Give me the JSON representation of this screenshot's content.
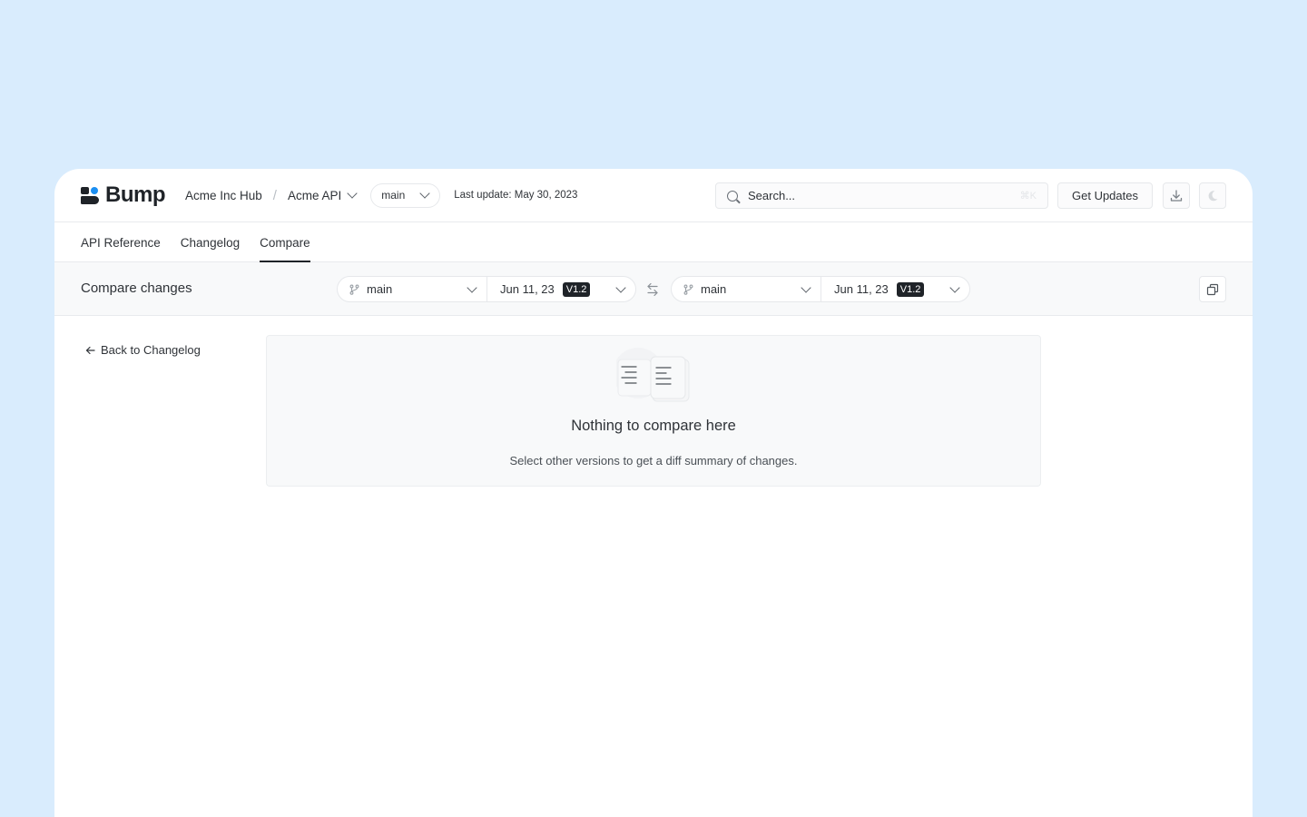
{
  "brand": {
    "name": "Bump",
    "accent": "#1b8ff2"
  },
  "header": {
    "hub_name": "Acme Inc Hub",
    "separator": "/",
    "api_name": "Acme API",
    "branch": "main",
    "last_update": "Last update: May 30, 2023",
    "search": {
      "placeholder": "Search...",
      "shortcut": "⌘K"
    },
    "get_updates_label": "Get Updates",
    "download_icon": "download-icon",
    "theme_icon": "moon-icon"
  },
  "tabs": [
    {
      "label": "API Reference",
      "active": false
    },
    {
      "label": "Changelog",
      "active": false
    },
    {
      "label": "Compare",
      "active": true
    }
  ],
  "compare": {
    "title": "Compare changes",
    "left": {
      "branch": "main",
      "date": "Jun 11, 23",
      "version": "V1.2"
    },
    "right": {
      "branch": "main",
      "date": "Jun 11, 23",
      "version": "V1.2"
    },
    "swap_icon": "swap-arrows-icon",
    "copy_icon": "copy-icon"
  },
  "main": {
    "back_label": "Back to Changelog",
    "empty": {
      "title": "Nothing to compare here",
      "subtitle": "Select other versions to get a diff summary of changes."
    }
  }
}
